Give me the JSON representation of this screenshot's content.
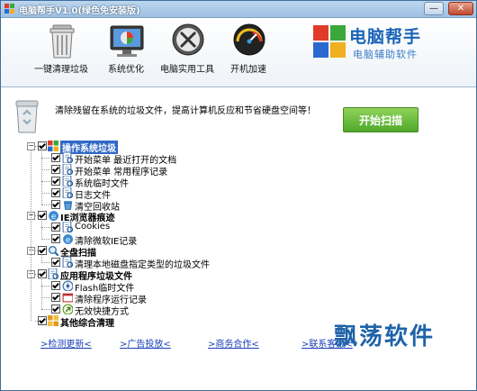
{
  "window": {
    "title": "电脑帮手V1.0(绿色免安装版)",
    "minimize_label": "—",
    "close_label": "✕"
  },
  "toolbar": {
    "items": [
      {
        "label": "一键清理垃圾",
        "icon": "trash-can-icon"
      },
      {
        "label": "系统优化",
        "icon": "monitor-icon"
      },
      {
        "label": "电脑实用工具",
        "icon": "tools-icon"
      },
      {
        "label": "开机加速",
        "icon": "speedometer-icon"
      }
    ]
  },
  "brand": {
    "title": "电脑帮手",
    "subtitle": "电脑辅助软件"
  },
  "main": {
    "description": "清除残留在系统的垃圾文件，提高计算机反应和节省硬盘空间等！",
    "start_button": "开始扫描"
  },
  "tree": [
    {
      "label": "操作系统垃圾",
      "icon": "windows-flag-icon",
      "bold": true,
      "selected": true,
      "checked": true,
      "children": [
        {
          "label": "开始菜单 最近打开的文档",
          "icon": "document-search-icon",
          "checked": true
        },
        {
          "label": "开始菜单 常用程序记录",
          "icon": "document-search-icon",
          "checked": true
        },
        {
          "label": "系统临时文件",
          "icon": "document-search-icon",
          "checked": true
        },
        {
          "label": "日志文件",
          "icon": "document-search-icon",
          "checked": true
        },
        {
          "label": "清空回收站",
          "icon": "recycle-bin-icon",
          "checked": true
        }
      ]
    },
    {
      "label": "IE浏览器痕迹",
      "icon": "ie-icon",
      "bold": true,
      "checked": true,
      "children": [
        {
          "label": "Cookies",
          "icon": "document-search-icon",
          "checked": true
        },
        {
          "label": "清除微软IE记录",
          "icon": "ie-icon",
          "checked": true
        }
      ]
    },
    {
      "label": "全盘扫描",
      "icon": "magnifier-icon",
      "bold": true,
      "checked": true,
      "children": [
        {
          "label": "清理本地磁盘指定类型的垃圾文件",
          "icon": "document-search-icon",
          "checked": true
        }
      ]
    },
    {
      "label": "应用程序垃圾文件",
      "icon": "document-search-icon",
      "bold": true,
      "checked": true,
      "children": [
        {
          "label": "Flash临时文件",
          "icon": "flash-icon",
          "checked": true
        },
        {
          "label": "清除程序运行记录",
          "icon": "program-icon",
          "checked": true
        },
        {
          "label": "无效快捷方式",
          "icon": "shortcut-icon",
          "checked": true
        }
      ]
    },
    {
      "label": "其他综合清理",
      "icon": "grid-icon",
      "bold": true,
      "checked": true,
      "children": []
    }
  ],
  "footer": {
    "links": [
      "检测更新",
      "广告投放",
      "商务合作",
      "联系客服"
    ],
    "watermark": "飘荡软件"
  },
  "colors": {
    "accent_blue": "#1a64b8",
    "start_green": "#4ea82a",
    "link_blue": "#1a3fb8",
    "selection": "#316ac5"
  }
}
